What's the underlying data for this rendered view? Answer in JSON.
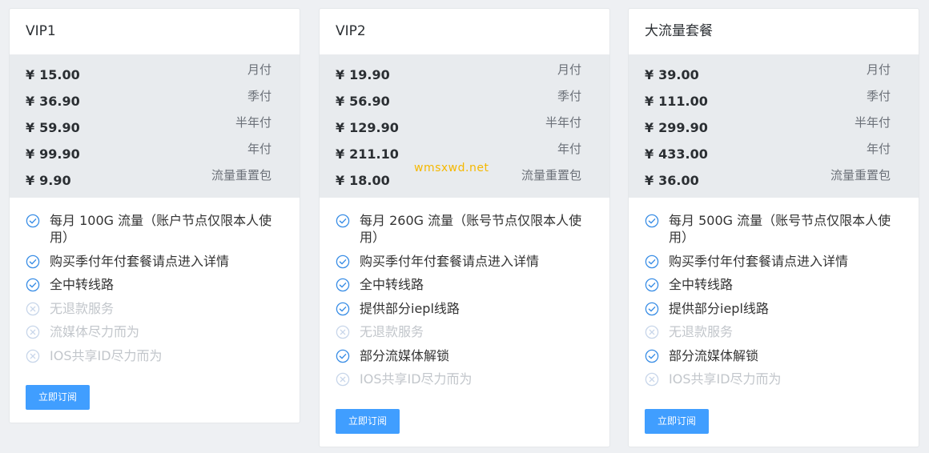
{
  "plans": [
    {
      "title": "VIP1",
      "prices": [
        {
          "amount": "15.00",
          "period": "月付"
        },
        {
          "amount": "36.90",
          "period": "季付"
        },
        {
          "amount": "59.90",
          "period": "半年付"
        },
        {
          "amount": "99.90",
          "period": "年付"
        },
        {
          "amount": "9.90",
          "period": "流量重置包"
        }
      ],
      "features": [
        {
          "text": "每月 100G 流量（账户节点仅限本人使用）",
          "enabled": true
        },
        {
          "text": "购买季付年付套餐请点进入详情",
          "enabled": true
        },
        {
          "text": "全中转线路",
          "enabled": true
        },
        {
          "text": "无退款服务",
          "enabled": false
        },
        {
          "text": "流媒体尽力而为",
          "enabled": false
        },
        {
          "text": "IOS共享ID尽力而为",
          "enabled": false
        }
      ],
      "button": "立即订阅"
    },
    {
      "title": "VIP2",
      "prices": [
        {
          "amount": "19.90",
          "period": "月付"
        },
        {
          "amount": "56.90",
          "period": "季付"
        },
        {
          "amount": "129.90",
          "period": "半年付"
        },
        {
          "amount": "211.10",
          "period": "年付"
        },
        {
          "amount": "18.00",
          "period": "流量重置包"
        }
      ],
      "watermark": "wmsxwd.net",
      "features": [
        {
          "text": "每月 260G 流量（账号节点仅限本人使用）",
          "enabled": true
        },
        {
          "text": "购买季付年付套餐请点进入详情",
          "enabled": true
        },
        {
          "text": "全中转线路",
          "enabled": true
        },
        {
          "text": "提供部分iepl线路",
          "enabled": true
        },
        {
          "text": "无退款服务",
          "enabled": false
        },
        {
          "text": "部分流媒体解锁",
          "enabled": true
        },
        {
          "text": "IOS共享ID尽力而为",
          "enabled": false
        }
      ],
      "button": "立即订阅"
    },
    {
      "title": "大流量套餐",
      "prices": [
        {
          "amount": "39.00",
          "period": "月付"
        },
        {
          "amount": "111.00",
          "period": "季付"
        },
        {
          "amount": "299.90",
          "period": "半年付"
        },
        {
          "amount": "433.00",
          "period": "年付"
        },
        {
          "amount": "36.00",
          "period": "流量重置包"
        }
      ],
      "features": [
        {
          "text": "每月 500G 流量（账号节点仅限本人使用）",
          "enabled": true
        },
        {
          "text": "购买季付年付套餐请点进入详情",
          "enabled": true
        },
        {
          "text": "全中转线路",
          "enabled": true
        },
        {
          "text": "提供部分iepl线路",
          "enabled": true
        },
        {
          "text": "无退款服务",
          "enabled": false
        },
        {
          "text": "部分流媒体解锁",
          "enabled": true
        },
        {
          "text": "IOS共享ID尽力而为",
          "enabled": false
        }
      ],
      "button": "立即订阅"
    }
  ],
  "currency_symbol": "¥",
  "colors": {
    "accent": "#409eff",
    "check": "#3a8ee6",
    "disabled": "#c2c6cb",
    "watermark": "#f5b800"
  },
  "icons": {
    "enabled": "check-circle-icon",
    "disabled": "close-circle-icon"
  }
}
